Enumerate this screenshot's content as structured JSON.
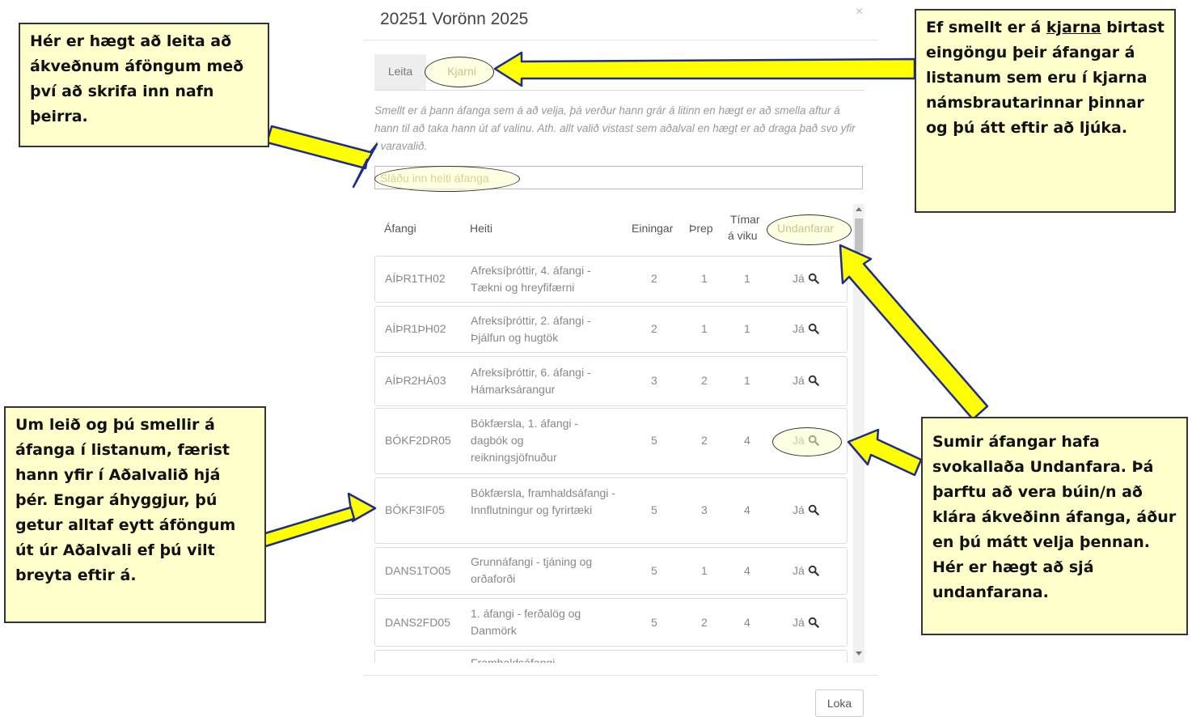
{
  "modal": {
    "title": "20251 Vorönn 2025",
    "close": "×",
    "tabs": [
      "Leita",
      "Kjarni"
    ],
    "help": "Smellt er á þann áfanga sem á að velja, þá verður hann grár á litinn en hægt er að smella aftur á hann til að taka hann út af valinu. Ath. allt valið vistast sem aðalval en hægt er að draga það svo yfir í varavalið.",
    "search_placeholder": "Sláðu inn heiti áfanga",
    "headers": {
      "code": "Áfangi",
      "name": "Heiti",
      "units": "Einingar",
      "level": "Þrep",
      "hours_1": "Tímar",
      "hours_2": "á viku",
      "prereq": "Undanfarar"
    },
    "courses": [
      {
        "code": "AÍÞR1TH02",
        "name": "Afreksíþróttir, 4. áfangi - Tækni og hreyfifærni",
        "units": "2",
        "level": "1",
        "hours": "1",
        "prereq": "Já"
      },
      {
        "code": "AÍÞR1ÞH02",
        "name": "Afreksíþróttir, 2. áfangi - Þjálfun og hugtök",
        "units": "2",
        "level": "1",
        "hours": "1",
        "prereq": "Já"
      },
      {
        "code": "AÍÞR2HÁ03",
        "name": "Afreksíþróttir, 6. áfangi - Hámarksárangur",
        "units": "3",
        "level": "2",
        "hours": "1",
        "prereq": "Já"
      },
      {
        "code": "BÓKF2DR05",
        "name": "Bókfærsla, 1. áfangi - dagbók og reikningsjöfnuður",
        "units": "5",
        "level": "2",
        "hours": "4",
        "prereq": "Já"
      },
      {
        "code": "BÓKF3IF05",
        "name": "Bókfærsla, framhaldsáfangi - Innflutningur og fyrirtæki",
        "units": "5",
        "level": "3",
        "hours": "4",
        "prereq": "Já"
      },
      {
        "code": "DANS1TO05",
        "name": "Grunnáfangi - tjáning og orðaforði",
        "units": "5",
        "level": "1",
        "hours": "4",
        "prereq": "Já"
      },
      {
        "code": "DANS2FD05",
        "name": "1. áfangi - ferðalög og Danmörk",
        "units": "5",
        "level": "2",
        "hours": "4",
        "prereq": "Já"
      },
      {
        "code": "",
        "name": "Framhaldsáfangi",
        "units": "",
        "level": "",
        "hours": "",
        "prereq": ""
      }
    ],
    "close_button": "Loka"
  },
  "notes": {
    "search": "Hér er hægt að leita að ákveðnum áföngum með því að skrifa inn nafn þeirra.",
    "core_pre": "Ef smellt er á ",
    "core_link": "kjarna",
    "core_post": " birtast eingöngu þeir áfangar á listanum sem eru í kjarna námsbrautarinnar þinnar og þú átt eftir að ljúka.",
    "main_choice": "Um leið og þú smellir á áfanga í listanum, færist hann yfir í Aðalvalið hjá þér. Engar áhyggjur, þú getur alltaf eytt áföngum út úr Aðalvali ef þú vilt breyta eftir á.",
    "prereq": "Sumir áfangar hafa svokallaða Undanfara. Þá þarftu að vera búin/n að klára ákveðinn áfanga, áður en þú mátt velja þennan. Hér er hægt að sjá undanfarana."
  },
  "colors": {
    "note_bg": "#ffffcc",
    "arrow_fill": "#ffff00",
    "arrow_stroke": "#1f2d8a"
  },
  "icons": [
    "magnifier-icon",
    "close-icon",
    "arrow-icon"
  ]
}
